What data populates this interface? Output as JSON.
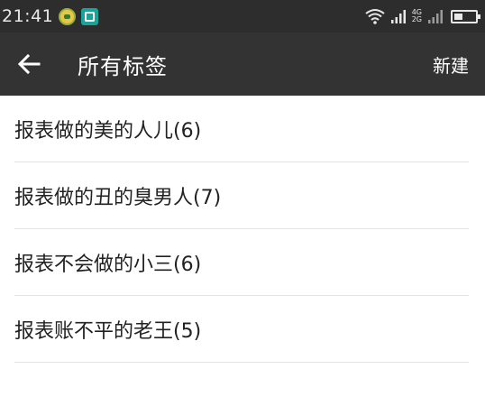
{
  "statusbar": {
    "time": "21:41",
    "icons": [
      "notification-icon",
      "scan-icon",
      "wifi-icon",
      "signal-icon",
      "signal-icon",
      "battery-icon"
    ],
    "network_top": "4G",
    "network_bottom": "2G"
  },
  "appbar": {
    "title": "所有标签",
    "action_label": "新建",
    "back_icon": "arrow-left-icon"
  },
  "tags": [
    {
      "label": "报表做的美的人儿(6)"
    },
    {
      "label": "报表做的丑的臭男人(7)"
    },
    {
      "label": "报表不会做的小三(6)"
    },
    {
      "label": "报表账不平的老王(5)"
    }
  ]
}
